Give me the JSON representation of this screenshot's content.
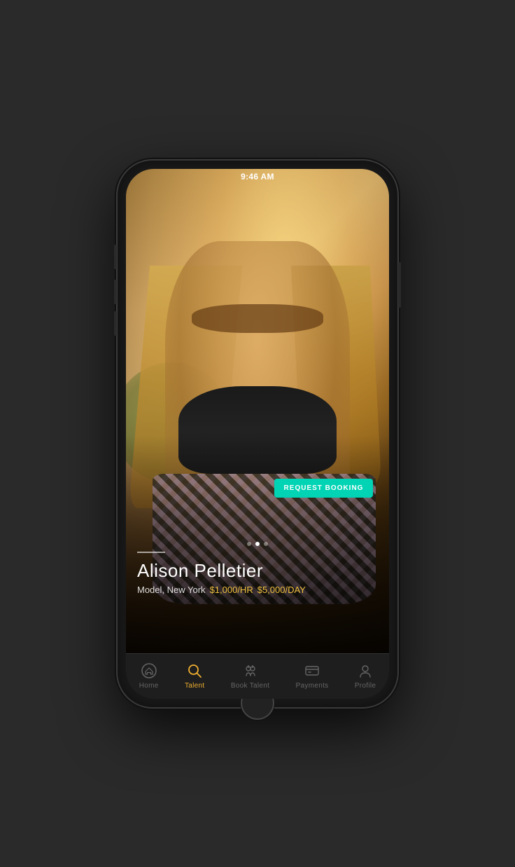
{
  "status_bar": {
    "time": "9:46 AM"
  },
  "hero": {
    "request_booking_label": "REQUEST BOOKING"
  },
  "pagination": {
    "dots": [
      false,
      true,
      false
    ]
  },
  "profile": {
    "name": "Alison Pelletier",
    "location": "Model, New York",
    "rate_hr": "$1,000/HR",
    "rate_day": "$5,000/DAY"
  },
  "bottom_nav": {
    "items": [
      {
        "id": "home",
        "label": "Home",
        "active": false
      },
      {
        "id": "talent",
        "label": "Talent",
        "active": true
      },
      {
        "id": "book-talent",
        "label": "Book Talent",
        "active": false
      },
      {
        "id": "payments",
        "label": "Payments",
        "active": false
      },
      {
        "id": "profile",
        "label": "Profile",
        "active": false
      }
    ]
  },
  "colors": {
    "accent": "#00d4b4",
    "nav_active": "#f0b030",
    "rate_color": "#f0c040"
  }
}
